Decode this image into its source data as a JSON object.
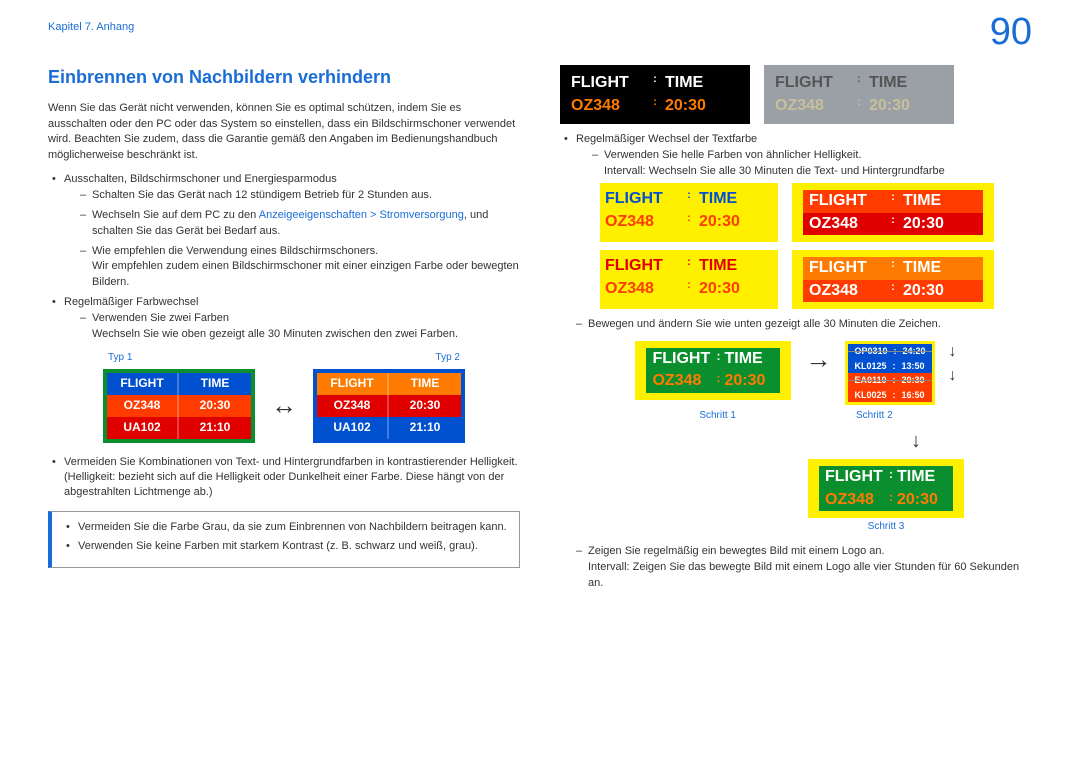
{
  "chapter": "Kapitel 7. Anhang",
  "page_number": "90",
  "title": "Einbrennen von Nachbildern verhindern",
  "intro": "Wenn Sie das Gerät nicht verwenden, können Sie es optimal schützen, indem Sie es ausschalten oder den PC oder das System so einstellen, dass ein Bildschirmschoner verwendet wird. Beachten Sie zudem, dass die Garantie gemäß den Angaben im Bedienungshandbuch möglicherweise beschränkt ist.",
  "b1": "Ausschalten, Bildschirmschoner und Energiesparmodus",
  "b1a": "Schalten Sie das Gerät nach 12 stündigem Betrieb für 2 Stunden aus.",
  "b1b_pre": "Wechseln Sie auf dem PC zu den ",
  "b1b_link": "Anzeigeeigenschaften > Stromversorgung",
  "b1b_post": ", und schalten Sie das Gerät bei Bedarf aus.",
  "b1c": "Wie empfehlen die Verwendung eines Bildschirmschoners.",
  "b1c2": "Wir empfehlen zudem einen Bildschirmschoner mit einer einzigen Farbe oder bewegten Bildern.",
  "b2": "Regelmäßiger Farbwechsel",
  "b2a": "Verwenden Sie zwei Farben",
  "b2a2": "Wechseln Sie wie oben gezeigt alle 30 Minuten zwischen den zwei Farben.",
  "typ1": "Typ 1",
  "typ2": "Typ 2",
  "ft": {
    "h1": "FLIGHT",
    "h2": "TIME",
    "r1c1": "OZ348",
    "r1c2": "20:30",
    "r2c1": "UA102",
    "r2c2": "21:10"
  },
  "b3": "Vermeiden Sie Kombinationen von Text- und Hintergrundfarben in kontrastierender Helligkeit. (Helligkeit: bezieht sich auf die Helligkeit oder Dunkelheit einer Farbe. Diese hängt von der abgestrahlten Lichtmenge ab.)",
  "callout1": "Vermeiden Sie die Farbe Grau, da sie zum Einbrennen von Nachbildern beitragen kann.",
  "callout2": "Verwenden Sie keine Farben mit starkem Kontrast (z. B. schwarz und weiß, grau).",
  "panel": {
    "h1": "FLIGHT",
    "h2": "TIME",
    "r1": "OZ348",
    "r2": "20:30"
  },
  "rb1": "Regelmäßiger Wechsel der Textfarbe",
  "rb1a": "Verwenden Sie helle Farben von ähnlicher Helligkeit.",
  "rb1a2": "Intervall: Wechseln Sie alle 30 Minuten die Text- und Hintergrundfarbe",
  "rb1b": "Bewegen und ändern Sie wie unten gezeigt alle 30 Minuten die Zeichen.",
  "schritt1": "Schritt 1",
  "schritt2": "Schritt 2",
  "schritt3": "Schritt 3",
  "scroll": {
    "s1": "OP0310",
    "s1t": "24:20",
    "s2": "KL0125",
    "s2t": "13:50",
    "s3": "EA0110",
    "s3t": "20:30",
    "s4": "KL0025",
    "s4t": "16:50"
  },
  "rb1c": "Zeigen Sie regelmäßig ein bewegtes Bild mit einem Logo an.",
  "rb1c2": "Intervall: Zeigen Sie das bewegte Bild mit einem Logo alle vier Stunden für 60 Sekunden an."
}
